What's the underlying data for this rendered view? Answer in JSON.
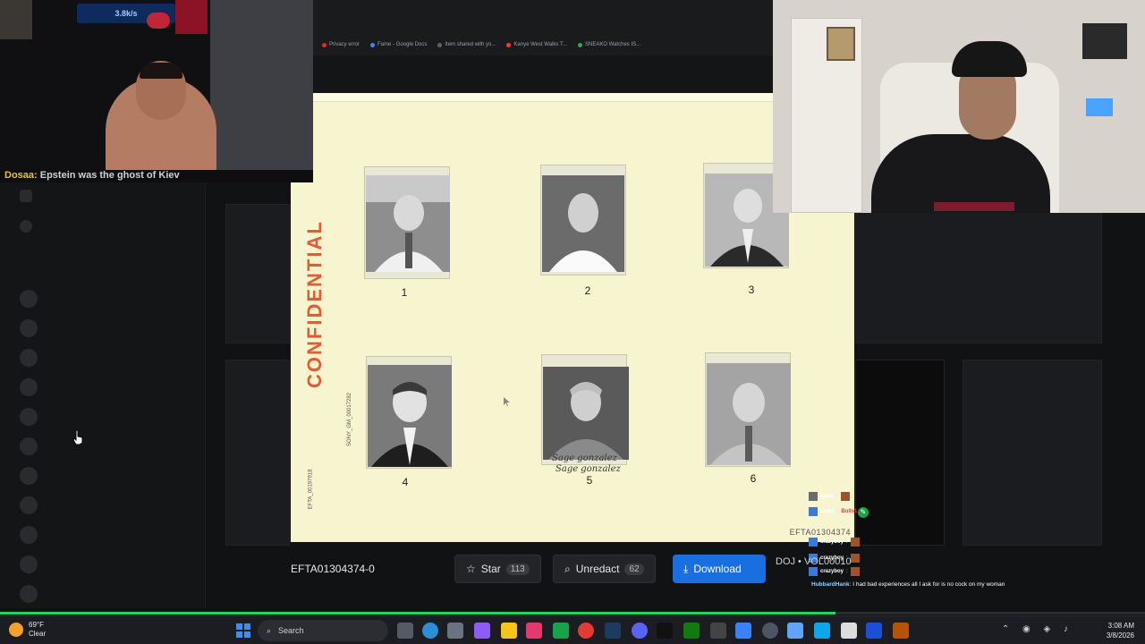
{
  "browser": {
    "bookmarks": [
      {
        "label": "Privacy error",
        "color": "#d93025"
      },
      {
        "label": "Fame - Google Docs",
        "color": "#4285f4"
      },
      {
        "label": "Item shared with yo...",
        "color": "#5f6368"
      },
      {
        "label": "Kanye West Walks T...",
        "color": "#ea4335"
      },
      {
        "label": "SNEAKO Watches IS...",
        "color": "#34a853"
      }
    ]
  },
  "document": {
    "stamp": "CONFIDENTIAL",
    "side_stamp": "SONY_GM_00017282",
    "side_stamp_2": "EFTA_00197918",
    "photos": [
      {
        "number": "1"
      },
      {
        "number": "2"
      },
      {
        "number": "3"
      },
      {
        "number": "4"
      },
      {
        "number": "5",
        "handwriting": [
          "Sage gonzalez",
          "Sage gonzalez"
        ]
      },
      {
        "number": "6"
      }
    ],
    "footer_id": "EFTA01304374"
  },
  "action_bar": {
    "doc_id": "EFTA01304374-0",
    "star_label": "Star",
    "star_count": "113",
    "unredact_label": "Unredact",
    "unredact_count": "62",
    "download_label": "Download",
    "accent": "#1a6fe0"
  },
  "stream": {
    "ticker_user": "Dosaa:",
    "ticker_text": "Epstein was the ghost of Kiev",
    "hud_text": "3.8k/s",
    "doj_label": "DOJ • VOL00010",
    "chat": [
      {
        "user": "igabs",
        "text": ":"
      },
      {
        "user": "igabs",
        "text": ":",
        "badge": "Bulls1"
      },
      {
        "user": "crazyboy",
        "text": ":"
      },
      {
        "user": "crazyboy",
        "text": ":"
      },
      {
        "user": "crazyboy",
        "text": ":"
      }
    ],
    "message_user": "HubbardHank",
    "message_text": ": I had bad experiences all I ask for is no cock on my woman"
  },
  "progress": {
    "value": 0.73,
    "color": "#1ed760"
  },
  "taskbar": {
    "weather_temp": "69°F",
    "weather_desc": "Clear",
    "search_label": "Search",
    "time": "3:08 AM",
    "date": "3/8/2026"
  }
}
